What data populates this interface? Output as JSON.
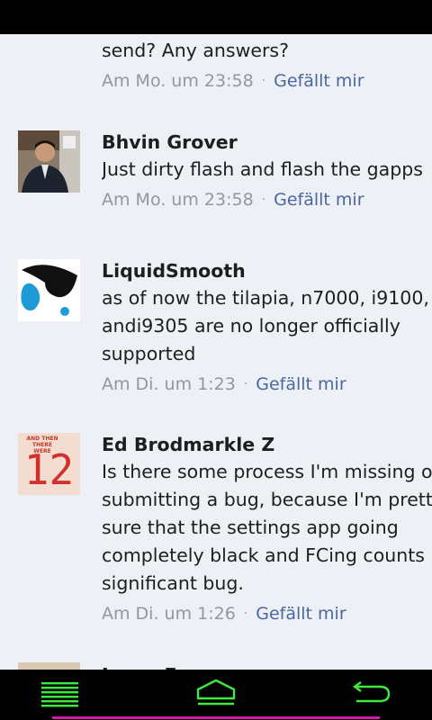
{
  "comments": [
    {
      "author": "",
      "lines": [
        "send? Any answers?"
      ],
      "time": "Am Mo. um 23:58",
      "like": "Gefällt mir"
    },
    {
      "author": "Bhvin Grover",
      "lines": [
        "Just dirty flash and flash the gapps"
      ],
      "time": "Am Mo. um 23:58",
      "like": "Gefällt mir"
    },
    {
      "author": "LiquidSmooth",
      "lines": [
        "as of now the tilapia, n7000, i9100,",
        "andi9305 are no longer officially",
        "supported"
      ],
      "time": "Am Di. um 1:23",
      "like": "Gefällt mir"
    },
    {
      "author": "Ed Brodmarkle Z",
      "lines": [
        "Is there some process I'm missing o",
        "submitting a bug, because I'm prett",
        "sure that the settings app going",
        "completely black and FCing counts",
        "significant bug."
      ],
      "time": "Am Di. um 1:26",
      "like": "Gefällt mir",
      "avatar_text": {
        "top": "AND THEN THERE WERE",
        "number": "12"
      }
    },
    {
      "author": "Jason Freeman"
    }
  ],
  "separator": "·",
  "navbar": {
    "menu_icon": "menu-icon",
    "home_icon": "home-icon",
    "back_icon": "back-icon",
    "accent_color": "#3dea3d"
  }
}
